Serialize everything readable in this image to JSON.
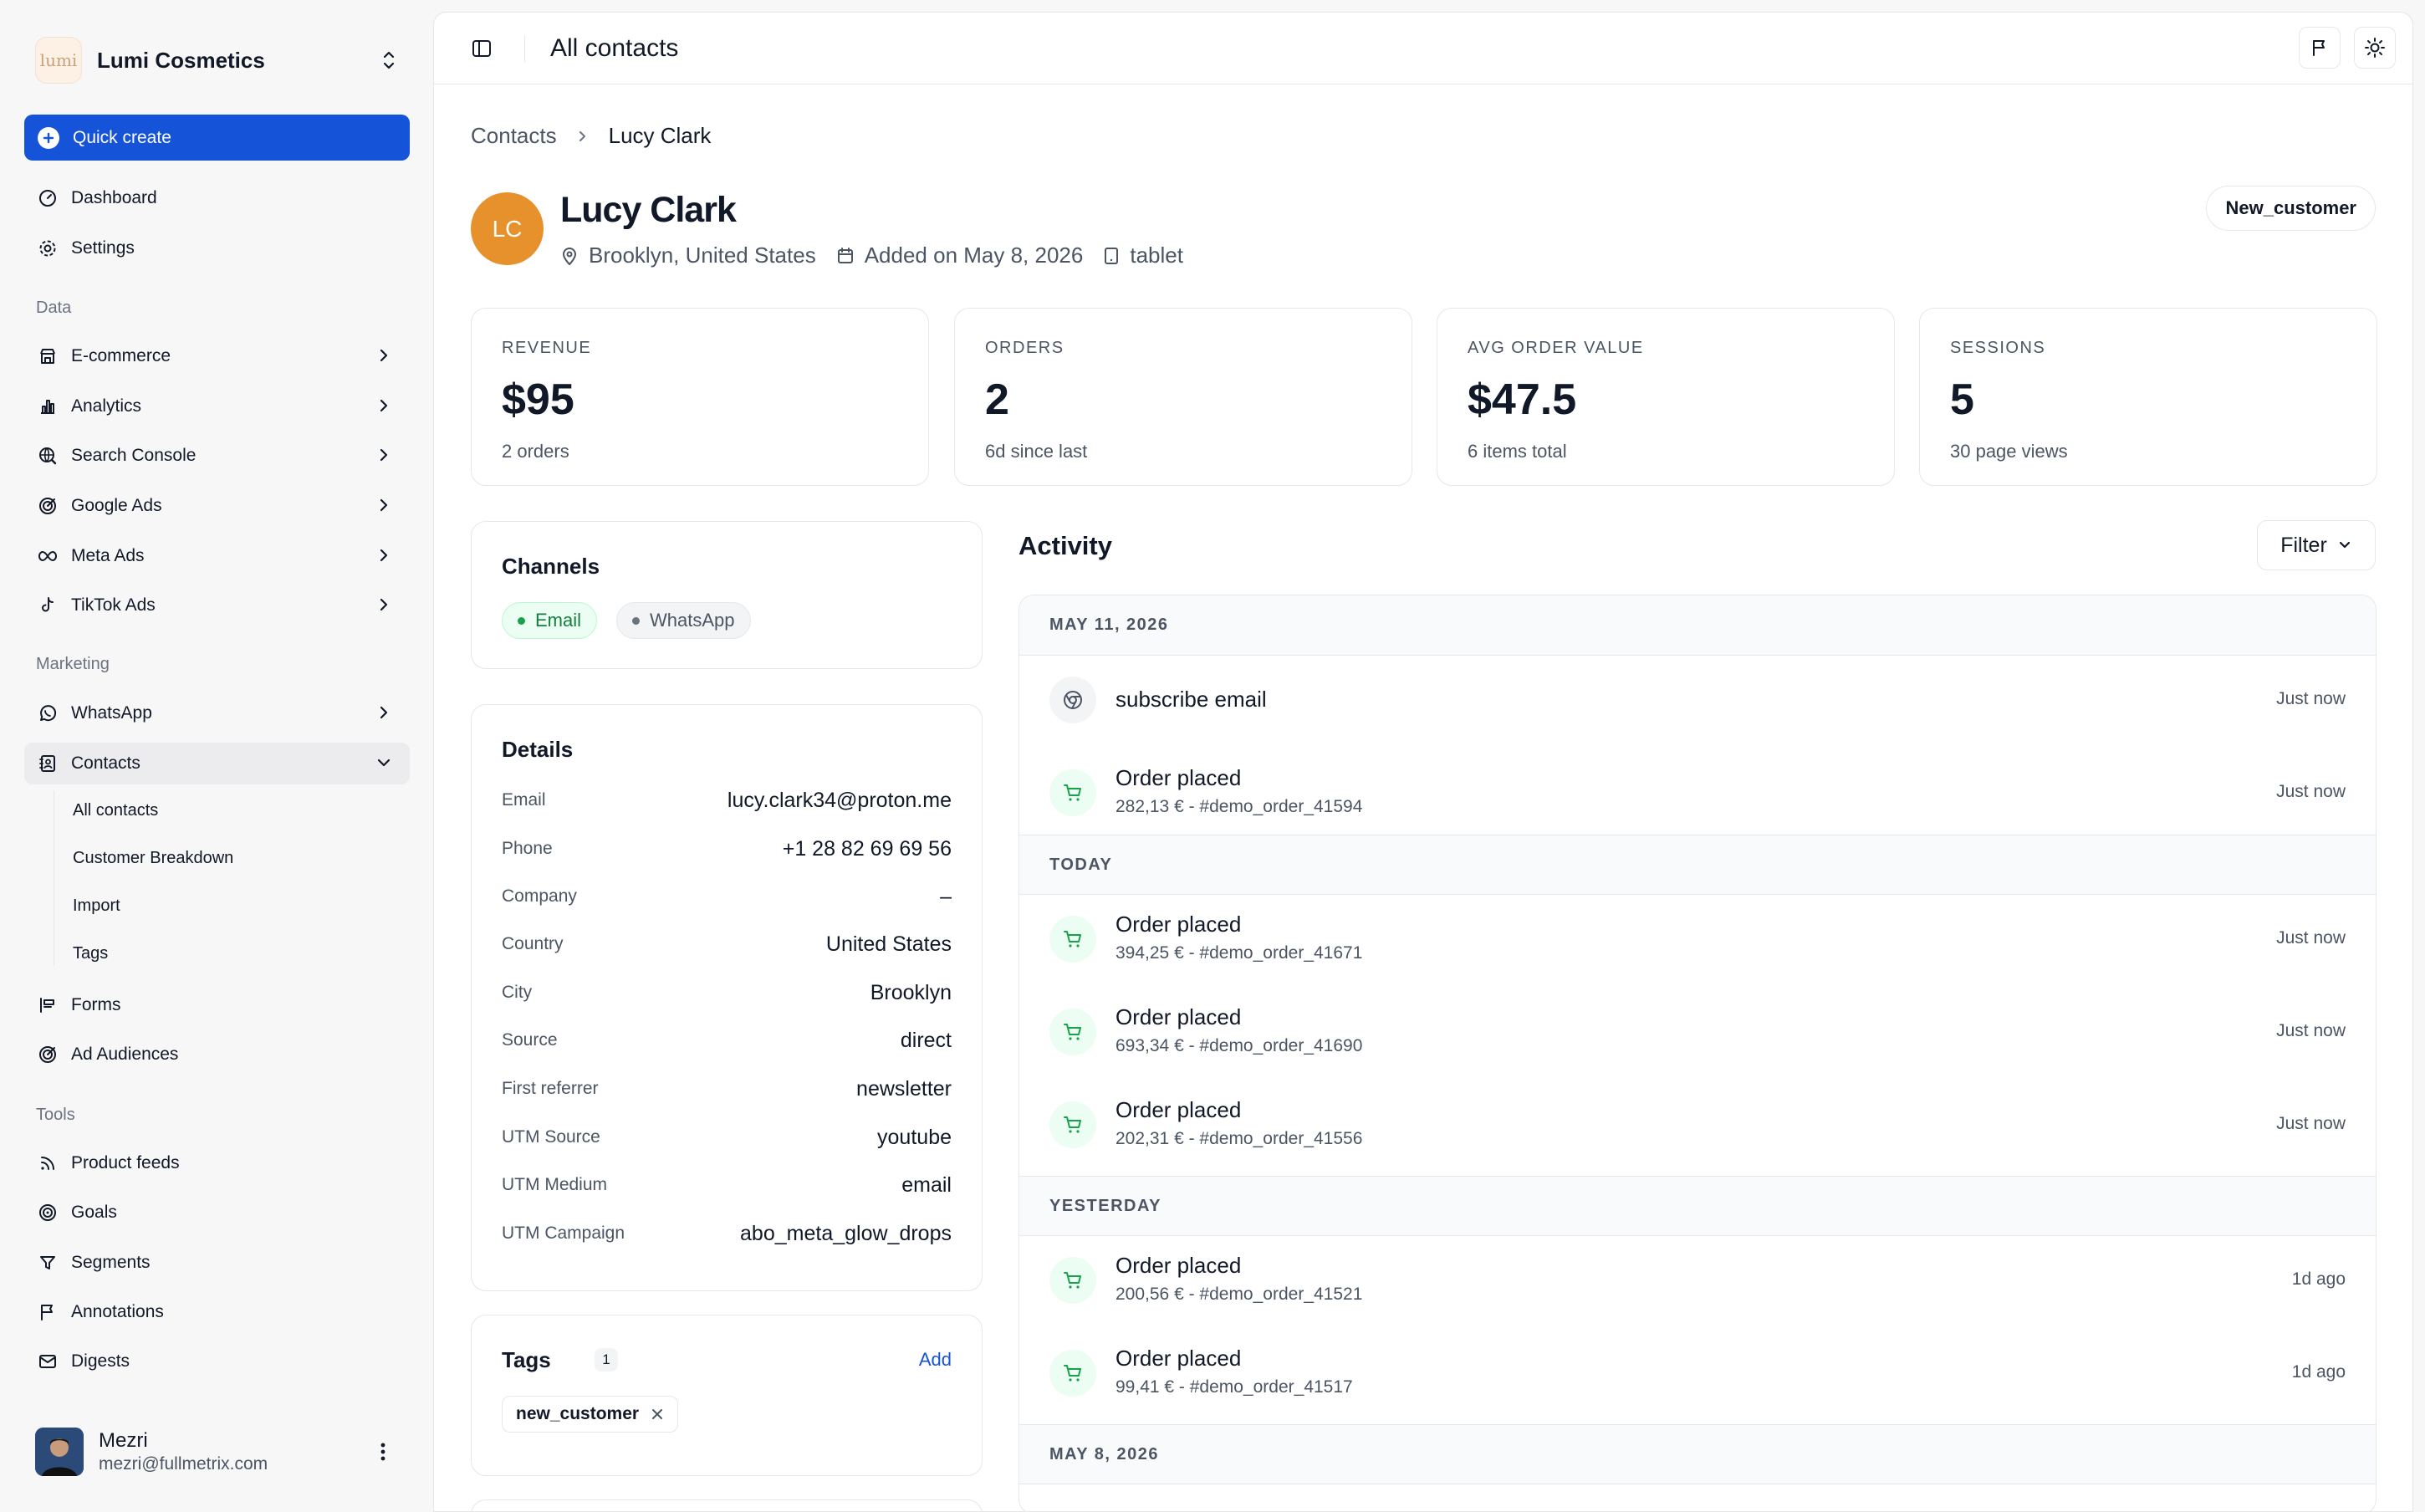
{
  "workspace": {
    "logo_text": "lumi",
    "name": "Lumi Cosmetics"
  },
  "quick_create": "Quick create",
  "nav_top": [
    {
      "label": "Dashboard",
      "icon": "dashboard-icon"
    },
    {
      "label": "Settings",
      "icon": "gear-icon"
    }
  ],
  "sections": {
    "data": "Data",
    "marketing": "Marketing",
    "tools": "Tools"
  },
  "nav_data": [
    {
      "label": "E-commerce",
      "icon": "store-icon"
    },
    {
      "label": "Analytics",
      "icon": "bar-chart-icon"
    },
    {
      "label": "Search Console",
      "icon": "globe-search-icon"
    },
    {
      "label": "Google Ads",
      "icon": "target-icon"
    },
    {
      "label": "Meta Ads",
      "icon": "infinity-icon"
    },
    {
      "label": "TikTok Ads",
      "icon": "tiktok-icon"
    }
  ],
  "nav_marketing": [
    {
      "label": "WhatsApp",
      "icon": "whatsapp-icon"
    },
    {
      "label": "Contacts",
      "icon": "contacts-icon"
    }
  ],
  "contacts_sub": [
    "All contacts",
    "Customer Breakdown",
    "Import",
    "Tags"
  ],
  "nav_marketing2": [
    {
      "label": "Forms",
      "icon": "form-icon"
    },
    {
      "label": "Ad Audiences",
      "icon": "target-icon"
    }
  ],
  "nav_tools": [
    {
      "label": "Product feeds",
      "icon": "rss-icon"
    },
    {
      "label": "Goals",
      "icon": "goal-icon"
    },
    {
      "label": "Segments",
      "icon": "filter-icon"
    },
    {
      "label": "Annotations",
      "icon": "flag-icon"
    },
    {
      "label": "Digests",
      "icon": "mail-icon"
    }
  ],
  "user": {
    "name": "Mezri",
    "email": "mezri@fullmetrix.com"
  },
  "topbar": {
    "title": "All contacts"
  },
  "breadcrumb": [
    "Contacts",
    "Lucy Clark"
  ],
  "contact": {
    "initials": "LC",
    "name": "Lucy Clark",
    "location": "Brooklyn, United States",
    "added": "Added on May 8, 2026",
    "device": "tablet",
    "segment_tag": "New_customer"
  },
  "stats": [
    {
      "label": "REVENUE",
      "value": "$95",
      "sub": "2 orders"
    },
    {
      "label": "ORDERS",
      "value": "2",
      "sub": "6d since last"
    },
    {
      "label": "AVG ORDER VALUE",
      "value": "$47.5",
      "sub": "6 items total"
    },
    {
      "label": "SESSIONS",
      "value": "5",
      "sub": "30 page views"
    }
  ],
  "channels": {
    "title": "Channels",
    "items": [
      "Email",
      "WhatsApp"
    ],
    "colors": {
      "active": "#15803d",
      "inactive": "#6b7280"
    }
  },
  "details": {
    "title": "Details",
    "rows": [
      {
        "k": "Email",
        "v": "lucy.clark34@proton.me"
      },
      {
        "k": "Phone",
        "v": "+1 28 82 69 69 56"
      },
      {
        "k": "Company",
        "v": "–"
      },
      {
        "k": "Country",
        "v": "United States"
      },
      {
        "k": "City",
        "v": "Brooklyn"
      },
      {
        "k": "Source",
        "v": "direct"
      },
      {
        "k": "First referrer",
        "v": "newsletter"
      },
      {
        "k": "UTM Source",
        "v": "youtube"
      },
      {
        "k": "UTM Medium",
        "v": "email"
      },
      {
        "k": "UTM Campaign",
        "v": "abo_meta_glow_drops"
      }
    ]
  },
  "tags": {
    "title": "Tags",
    "count": "1",
    "add": "Add",
    "items": [
      "new_customer"
    ]
  },
  "activity": {
    "title": "Activity",
    "filter": "Filter",
    "groups": [
      {
        "date": "MAY 11, 2026",
        "events": [
          {
            "title": "subscribe email",
            "sub": "",
            "time": "Just now",
            "icon": "chrome-icon"
          },
          {
            "title": "Order placed",
            "sub": "282,13 € - #demo_order_41594",
            "time": "Just now",
            "icon": "cart-icon"
          }
        ]
      },
      {
        "date": "TODAY",
        "events": [
          {
            "title": "Order placed",
            "sub": "394,25 € - #demo_order_41671",
            "time": "Just now",
            "icon": "cart-icon"
          },
          {
            "title": "Order placed",
            "sub": "693,34 € - #demo_order_41690",
            "time": "Just now",
            "icon": "cart-icon"
          },
          {
            "title": "Order placed",
            "sub": "202,31 € - #demo_order_41556",
            "time": "Just now",
            "icon": "cart-icon"
          }
        ]
      },
      {
        "date": "YESTERDAY",
        "events": [
          {
            "title": "Order placed",
            "sub": "200,56 € - #demo_order_41521",
            "time": "1d ago",
            "icon": "cart-icon"
          },
          {
            "title": "Order placed",
            "sub": "99,41 € - #demo_order_41517",
            "time": "1d ago",
            "icon": "cart-icon"
          }
        ]
      },
      {
        "date": "MAY 8, 2026",
        "events": []
      }
    ]
  },
  "colors": {
    "accent": "#1553d8",
    "avatar": "#e7912d",
    "order_icon_bg": "#ecfdf3",
    "order_icon": "#16a34a"
  }
}
